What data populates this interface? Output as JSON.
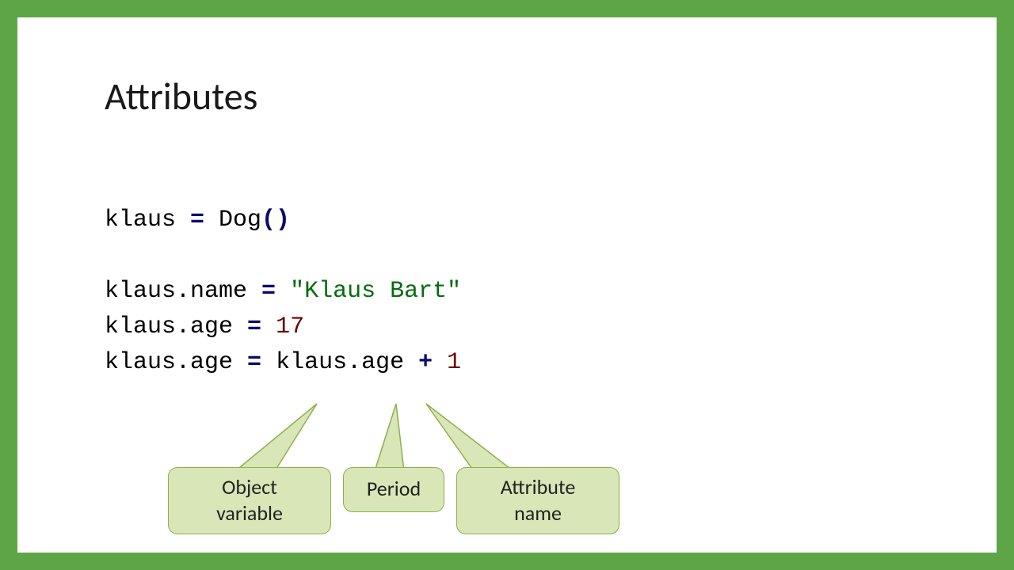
{
  "title": "Attributes",
  "code": {
    "line1": {
      "var": "klaus",
      "eq": " = ",
      "cls": "Dog",
      "paren": "()"
    },
    "line2": {
      "obj": "klaus",
      "dot": ".",
      "attr": "name",
      "eq": " = ",
      "str": "\"Klaus Bart\""
    },
    "line3": {
      "obj": "klaus",
      "dot": ".",
      "attr": "age",
      "eq": " = ",
      "num": "17"
    },
    "line4": {
      "obj1": "klaus",
      "dot1": ".",
      "attr1": "age",
      "eq": " = ",
      "obj2": "klaus",
      "dot2": ".",
      "attr2": "age",
      "plus": " + ",
      "num": "1"
    }
  },
  "callouts": {
    "object_variable": "Object\nvariable",
    "period": "Period",
    "attribute_name": "Attribute\nname"
  }
}
